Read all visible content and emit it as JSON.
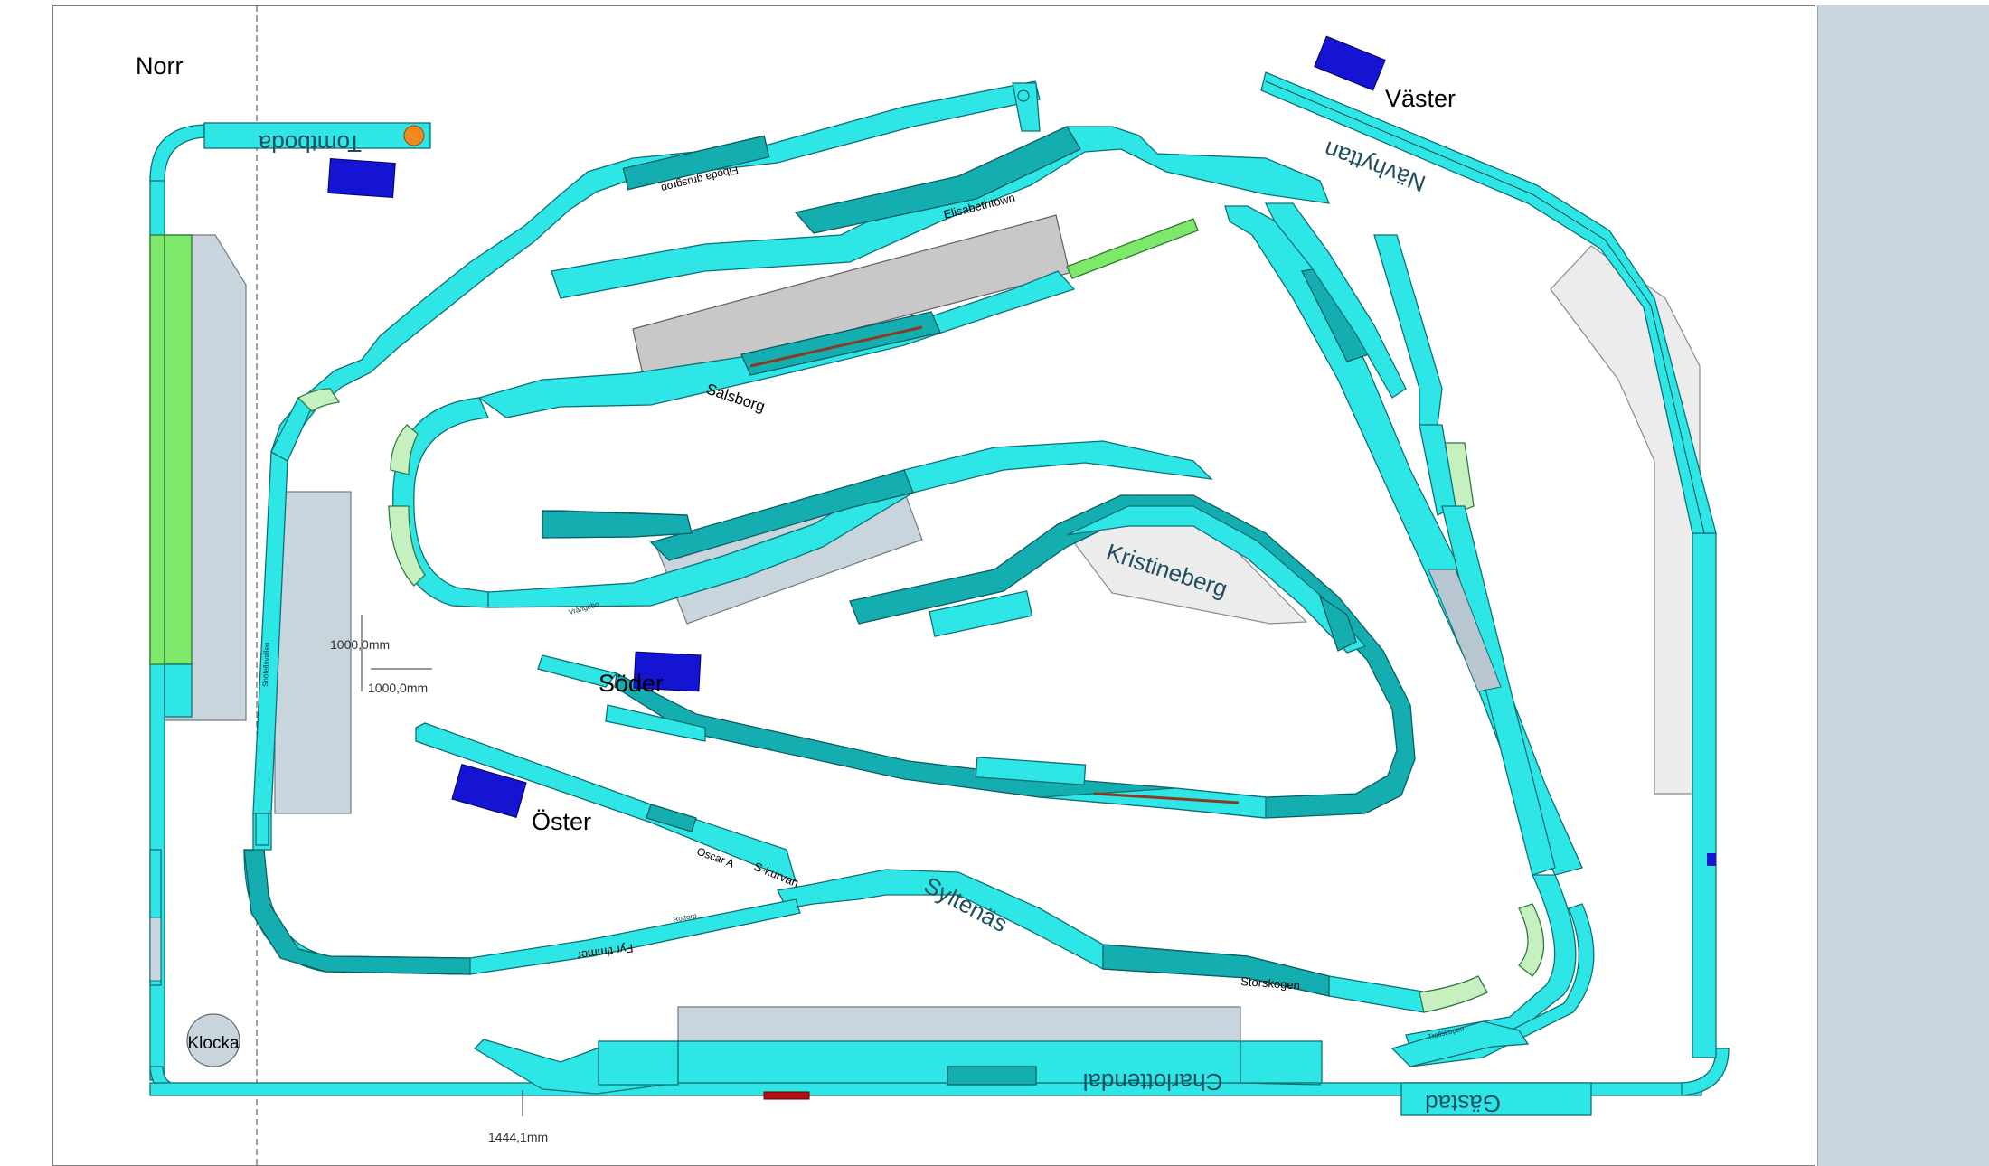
{
  "compass": {
    "north": "Norr",
    "west": "Väster",
    "south": "Söder",
    "east": "Öster"
  },
  "clock": "Klocka",
  "dimensions": {
    "horizontal": "1000,0mm",
    "vertical": "1000,0mm",
    "bottom": "1444,1mm"
  },
  "stations": {
    "kristineberg": "Kristineberg",
    "charlottendal": "Charlottendal",
    "syltenas": "Syltenäs",
    "salsborg": "Salsborg",
    "navhyttan": "Nävhyttan",
    "tomtboda": "Tomtboda",
    "elisabethtown": "Elisabethtown",
    "flboda_grusgrop": "Flboda grusgrop",
    "storskogen": "Storskogen",
    "gastad": "Gästad",
    "s_kurvan": "S-kurvan",
    "oscar_a": "Oscar A",
    "vrangebo": "Vrångebo",
    "snofellsvallen": "Snöfellsvallen",
    "fyr_timmer": "Fyr timmer",
    "trollskogen": "Trollskogen",
    "rottorp": "Rottorp"
  },
  "colors": {
    "track": "#2ee6e6",
    "track_dark": "#15aeb0",
    "track_light_green": "#c6f0c0",
    "track_green": "#7de86a",
    "building": "#c9d5dd",
    "marker_blue": "#1414d2",
    "panel": "#c8d6e0"
  }
}
